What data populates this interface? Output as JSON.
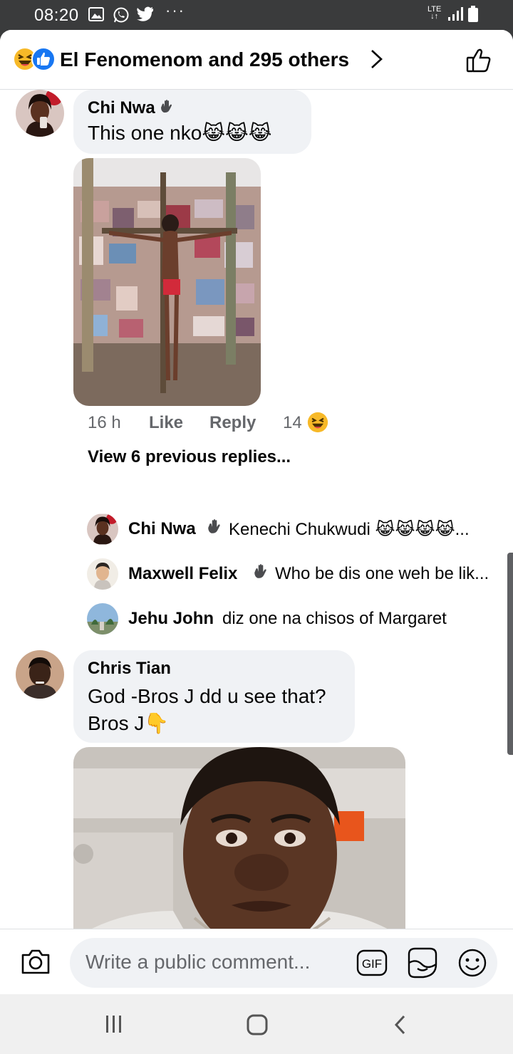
{
  "status_bar": {
    "time": "08:20",
    "network": "LTE",
    "icons": [
      "gallery-icon",
      "whatsapp-icon",
      "twitter-icon",
      "more-dots-icon",
      "signal-icon",
      "battery-icon"
    ]
  },
  "header": {
    "title": "El Fenomenom and 295 others",
    "reaction_icons": [
      "haha-reaction-icon",
      "like-reaction-icon"
    ]
  },
  "comments": [
    {
      "author": "Chi Nwa",
      "text": "This one nko",
      "emoji": "😹😹😹",
      "time": "16 h",
      "like_label": "Like",
      "reply_label": "Reply",
      "reaction_count": "14"
    },
    {
      "author": "Chris Tian",
      "text_line1": "God -Bros J dd u see that?",
      "text_line2": "Bros J",
      "emoji": "👇"
    }
  ],
  "view_previous": "View 6 previous replies...",
  "replies": [
    {
      "author": "Chi Nwa",
      "text": "Kenechi Chukwudi 😹😹😹😹..."
    },
    {
      "author": "Maxwell Felix",
      "text": "Who be dis one weh be lik..."
    },
    {
      "author": "Jehu John",
      "text": "diz one na chisos of Margaret"
    }
  ],
  "composer": {
    "placeholder": "Write a public comment...",
    "gif_label": "GIF"
  },
  "colors": {
    "bubble": "#f0f2f5",
    "secondary_text": "#65676b",
    "status_bar": "#3a3b3c",
    "like_blue": "#1877f2",
    "haha_yellow": "#f7b928"
  }
}
